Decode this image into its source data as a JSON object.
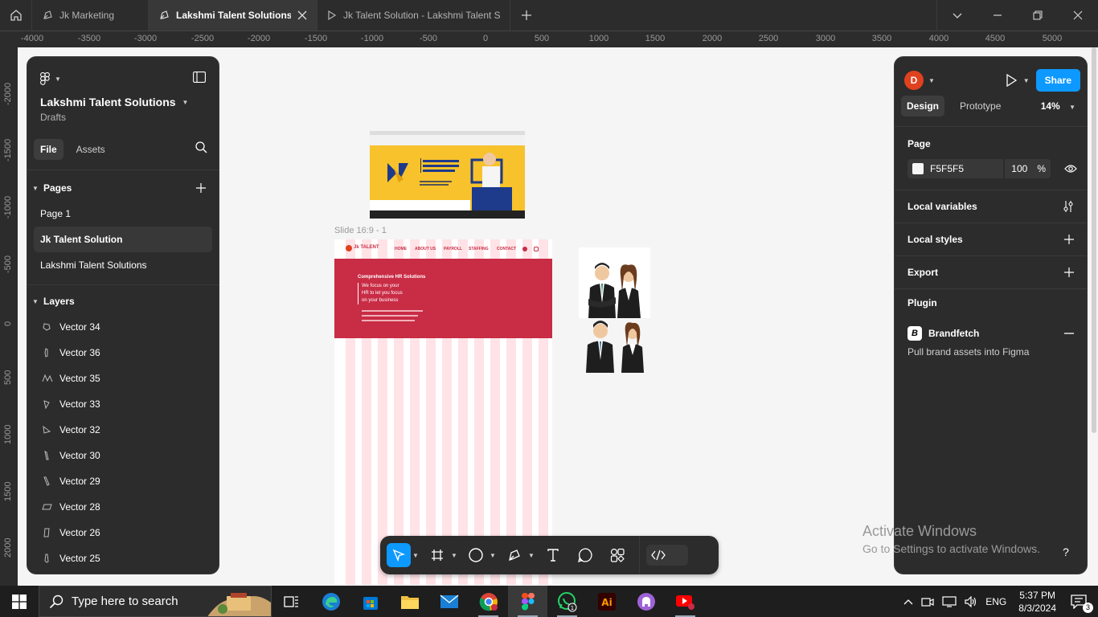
{
  "tabs": [
    {
      "label": "Jk Marketing",
      "active": false
    },
    {
      "label": "Lakshmi Talent Solutions",
      "active": true
    },
    {
      "label": "Jk Talent Solution - Lakshmi Talent Sc",
      "active": false
    }
  ],
  "ruler": {
    "horizontal": [
      "-4000",
      "-3500",
      "-3000",
      "-2500",
      "-2000",
      "-1500",
      "-1000",
      "-500",
      "0",
      "500",
      "1000",
      "1500",
      "2000",
      "2500",
      "3000",
      "3500",
      "4000",
      "4500",
      "5000"
    ],
    "vertical": [
      "-2000",
      "-1500",
      "-1000",
      "-500",
      "0",
      "500",
      "1000",
      "1500",
      "2000"
    ]
  },
  "file": {
    "title": "Lakshmi Talent Solutions",
    "location": "Drafts"
  },
  "left_tabs": {
    "file": "File",
    "assets": "Assets"
  },
  "pages": {
    "header": "Pages",
    "items": [
      "Page 1",
      "Jk Talent Solution",
      "Lakshmi Talent Solutions"
    ],
    "selected_index": 1
  },
  "layers": {
    "header": "Layers",
    "items": [
      "Vector 34",
      "Vector 36",
      "Vector 35",
      "Vector 33",
      "Vector 32",
      "Vector 30",
      "Vector 29",
      "Vector 28",
      "Vector 26",
      "Vector 25"
    ]
  },
  "right": {
    "avatar_letter": "D",
    "share_label": "Share",
    "tabs": {
      "design": "Design",
      "prototype": "Prototype"
    },
    "zoom": "14%",
    "page_header": "Page",
    "page_color": "F5F5F5",
    "page_opacity": "100",
    "percent": "%",
    "local_variables": "Local variables",
    "local_styles": "Local styles",
    "export": "Export",
    "plugin_header": "Plugin",
    "plugin_name": "Brandfetch",
    "plugin_desc": "Pull brand assets into Figma"
  },
  "canvas": {
    "slide_label": "Slide 16:9 - 1",
    "slide_nav": [
      "HOME",
      "ABOUT US",
      "PAYROLL",
      "STAFFING",
      "CONTACT"
    ],
    "slide_logo": "Jk TALENT",
    "hero_heading": "Comprehensive HR Solutions",
    "hero_lines": [
      "We focus on your",
      "HR to let you focus",
      "on your business"
    ]
  },
  "watermark": {
    "line1": "Activate Windows",
    "line2": "Go to Settings to activate Windows."
  },
  "taskbar": {
    "search_placeholder": "Type here to search",
    "language": "ENG",
    "time": "5:37 PM",
    "date": "8/3/2024",
    "notification_count": "3"
  },
  "colors": {
    "accent": "#0d99ff",
    "panel": "#2c2c2c",
    "avatar": "#e0411f",
    "hero": "#c92c45"
  }
}
